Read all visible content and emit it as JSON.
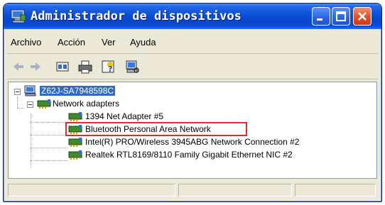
{
  "window": {
    "title": "Administrador de dispositivos"
  },
  "menu": [
    "Archivo",
    "Acción",
    "Ver",
    "Ayuda"
  ],
  "toolbar": {
    "icons": [
      "back-arrow-icon",
      "forward-arrow-icon",
      "properties-icon",
      "print-icon",
      "help-icon",
      "scan-hardware-icon"
    ]
  },
  "tree": {
    "root": "Z62J-SA7948598C",
    "category": "Network adapters",
    "devices": [
      "1394 Net Adapter #5",
      "Bluetooth Personal Area Network",
      "Intel(R) PRO/Wireless 3945ABG Network Connection #2",
      "Realtek RTL8169/8110 Family Gigabit Ethernet NIC #2"
    ],
    "highlighted_device_index": 1
  },
  "colors": {
    "title_bar": "#0a4fd7",
    "selection": "#316ac5",
    "highlight_box": "#e12a2a",
    "window_bg": "#ece9d8"
  }
}
